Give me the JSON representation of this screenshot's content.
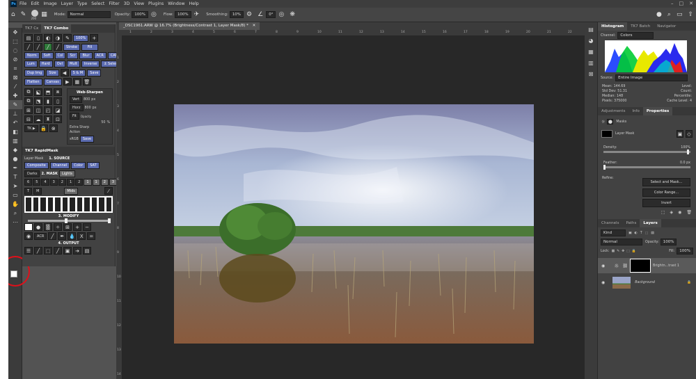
{
  "menubar": {
    "logo": "Ps",
    "items": [
      "File",
      "Edit",
      "Image",
      "Layer",
      "Type",
      "Select",
      "Filter",
      "3D",
      "View",
      "Plugins",
      "Window",
      "Help"
    ]
  },
  "options": {
    "brush_size": "200",
    "mode_label": "Mode:",
    "mode_value": "Normal",
    "opacity_label": "Opacity:",
    "opacity_value": "100%",
    "flow_label": "Flow:",
    "flow_value": "100%",
    "smoothing_label": "Smoothing:",
    "smoothing_value": "10%",
    "angle_value": "0°"
  },
  "document": {
    "tab_title": "_DSC1961.ARW @ 16.7% (Brightness/Contrast 1, Layer Mask/8) *",
    "ruler_ticks": [
      "1",
      "2",
      "3",
      "4",
      "5",
      "6",
      "7",
      "8",
      "9",
      "10",
      "11",
      "12",
      "13",
      "14",
      "15",
      "16",
      "17",
      "18",
      "19",
      "20",
      "21",
      "22"
    ],
    "ruler_v_ticks": [
      "1",
      "2",
      "3",
      "4",
      "5",
      "6",
      "7",
      "8",
      "9",
      "10",
      "11",
      "12",
      "13",
      "14"
    ]
  },
  "tk": {
    "tabs": [
      "TK7 Cx",
      "TK7 Combo"
    ],
    "zoom": "100%",
    "row2": [
      "Stroke",
      "Fill"
    ],
    "row3": [
      "Norm",
      "Soft",
      "Col",
      "Scr",
      "Blur",
      "ACR",
      "CAF"
    ],
    "row4": [
      "Lum",
      "Hard",
      "Ovl",
      "Mult",
      "Inverse",
      "± Select"
    ],
    "row5": [
      "Dup Img",
      "Size",
      "S & M",
      "Save"
    ],
    "row6": [
      "Flatten",
      "Canvas"
    ],
    "websharpen": "Web-Sharpen",
    "vert_label": "Vert",
    "vert_value": "800",
    "horz_label": "Horz",
    "horz_value": "800",
    "px": "px",
    "fit_label": "Fit",
    "opacity_label": "Opacity",
    "opacity_value": "50",
    "pct": "%",
    "extra_sharp": "Extra Sharp",
    "action": "Action",
    "srgb": "sRGB",
    "save": "Save",
    "tk_label": "TK ▶",
    "rapidmask_title": "TK7 RapidMask",
    "layer_mask": "Layer Mask",
    "source_title": "1. SOURCE",
    "source_btns": [
      "Composite",
      "Channel",
      "Color",
      "SAT"
    ],
    "mask_title": "2. MASK",
    "darks": "Darks",
    "lights": "Lights",
    "numbers": [
      "6",
      "5",
      "4",
      "3",
      "2",
      "1",
      "2",
      "1",
      "1",
      "2",
      "3",
      "4",
      "5",
      "6"
    ],
    "t_btn": "T",
    "m_btn": "M",
    "mids": "Mids",
    "modify_title": "3. MODIFY",
    "acr": "ACR",
    "output_title": "4. OUTPUT"
  },
  "histogram": {
    "tabs": [
      "Histogram",
      "TK7 Batch",
      "Navigator"
    ],
    "channel_label": "Channel:",
    "channel_value": "Colors",
    "source_label": "Source:",
    "source_value": "Entire Image",
    "stats_left": [
      [
        "Mean:",
        "144.69"
      ],
      [
        "Std Dev:",
        "51.31"
      ],
      [
        "Median:",
        "148"
      ],
      [
        "Pixels:",
        "375000"
      ]
    ],
    "stats_right": [
      [
        "Level:",
        ""
      ],
      [
        "Count:",
        ""
      ],
      [
        "Percentile:",
        ""
      ],
      [
        "Cache Level:",
        "4"
      ]
    ]
  },
  "properties": {
    "tabs": [
      "Adjustments",
      "Info",
      "Properties"
    ],
    "masks_label": "Masks",
    "layer_mask_label": "Layer Mask",
    "density_label": "Density:",
    "density_value": "100%",
    "feather_label": "Feather:",
    "feather_value": "0.0 px",
    "refine_label": "Refine:",
    "buttons": [
      "Select and Mask...",
      "Color Range...",
      "Invert"
    ]
  },
  "layers": {
    "tabs": [
      "Channels",
      "Paths",
      "Layers"
    ],
    "kind": "Kind",
    "blend": "Normal",
    "opacity_label": "Opacity:",
    "opacity_value": "100%",
    "lock_label": "Lock:",
    "fill_label": "Fill:",
    "fill_value": "100%",
    "rows": [
      {
        "name": "Brightn...trast 1"
      },
      {
        "name": "Background"
      }
    ]
  }
}
